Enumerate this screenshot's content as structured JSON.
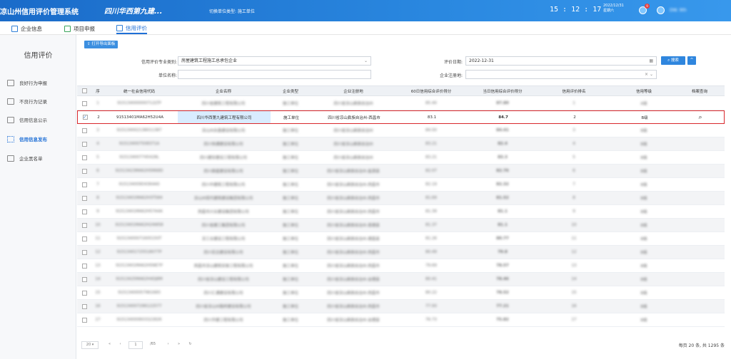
{
  "header": {
    "system_title": "凉山州信用评价管理系统",
    "company_name": "四川华西第九建...",
    "switch_type": "切换单位类型: 施工单位",
    "time": "15 : 12 : 17",
    "date": "2022/12/31",
    "weekday": "星期六",
    "badge_count": "9",
    "user_name": "DW. 9th"
  },
  "nav_tabs": [
    {
      "label": "企业信息",
      "icon": "building-icon"
    },
    {
      "label": "项目申报",
      "icon": "document-icon"
    },
    {
      "label": "信用评价",
      "icon": "columns-icon",
      "active": true
    }
  ],
  "sidebar": {
    "title": "信用评价",
    "items": [
      {
        "label": "良好行为申报",
        "icon": "report-icon"
      },
      {
        "label": "不良行为记录",
        "icon": "record-icon"
      },
      {
        "label": "信用信息公示",
        "icon": "home-icon"
      },
      {
        "label": "信用信息发布",
        "icon": "publish-icon",
        "active": true
      },
      {
        "label": "企业黑名单",
        "icon": "blacklist-icon"
      }
    ]
  },
  "toolbar": {
    "export_label": "⇪ 打开导出面板"
  },
  "filters": {
    "category_label": "信用评价专业类别:",
    "category_value": "房屋建筑工程施工总承包企业",
    "unit_label": "单位名称:",
    "unit_value": "",
    "eval_date_label": "评价日期:",
    "eval_date_value": "2022-12-31",
    "region_label": "企业注册地:",
    "region_value": "",
    "search_label": "搜索",
    "collapse_label": "^"
  },
  "table": {
    "columns": [
      "序",
      "统一社会信用代码",
      "企业名称",
      "企业类型",
      "企业注册地",
      "60日信用综合评价得分",
      "当日信用综合评价得分",
      "信用评价排名",
      "信用等级",
      "档案查询"
    ],
    "rows": [
      {
        "no": "1",
        "code": "915134000000712LTP",
        "name": "四川省建筑工程有限公司",
        "type": "施工单位",
        "region": "四川省凉山彝族自治州",
        "score60": "85.40",
        "score": "87.80",
        "rank": "1",
        "grade": "A级",
        "blurred": true
      },
      {
        "no": "2",
        "code": "91513401MA62H52U4A",
        "name": "四川华西第九建筑工程有限公司",
        "type": "施工单位",
        "region": "四川省凉山彝族自治州-西昌市",
        "score60": "83.1",
        "score": "84.7",
        "rank": "2",
        "grade": "B级",
        "selected": true
      },
      {
        "no": "3",
        "code": "915134002138011387",
        "name": "凉山州永鑫建设有限公司",
        "type": "施工单位",
        "region": "四川省凉山彝族自治州",
        "score60": "84.50",
        "score": "84.41",
        "rank": "3",
        "grade": "B级",
        "blurred": true
      },
      {
        "no": "4",
        "code": "915134007508371A",
        "name": "四川恒通建设有限公司",
        "type": "施工单位",
        "region": "四川省凉山彝族自治州",
        "score60": "83.21",
        "score": "82.4",
        "rank": "4",
        "grade": "B级",
        "blurred": true
      },
      {
        "no": "5",
        "code": "915134007745428L",
        "name": "四川建安建设工程有限公司",
        "type": "施工单位",
        "region": "四川省凉山彝族自治州",
        "score60": "83.21",
        "score": "83.3",
        "rank": "5",
        "grade": "B级",
        "blurred": true
      },
      {
        "no": "6",
        "code": "91513423MA62H5RN9D",
        "name": "四川鼎盛建设有限公司",
        "type": "施工单位",
        "region": "四川省凉山彝族自治州-盐源县",
        "score60": "82.07",
        "score": "82.76",
        "rank": "6",
        "grade": "B级",
        "blurred": true
      },
      {
        "no": "7",
        "code": "915134009D4364A0",
        "name": "四川中建筑工程有限公司",
        "type": "施工单位",
        "region": "四川省凉山彝族自治州-西昌市",
        "score60": "82.19",
        "score": "82.32",
        "rank": "7",
        "grade": "B级",
        "blurred": true
      },
      {
        "no": "8",
        "code": "91513401MA62H3T584",
        "name": "凉山州现代建筑建设集团有限公司",
        "type": "施工单位",
        "region": "四川省凉山彝族自治州-西昌市",
        "score60": "81.69",
        "score": "81.52",
        "rank": "8",
        "grade": "B级",
        "blurred": true
      },
      {
        "no": "9",
        "code": "91513401MA62H57A4A",
        "name": "西昌市兴业建设集团有限公司",
        "type": "施工单位",
        "region": "四川省凉山彝族自治州-西昌市",
        "score60": "81.39",
        "score": "81.1",
        "rank": "9",
        "grade": "B级",
        "blurred": true
      },
      {
        "no": "10",
        "code": "91513401MA62H24W58",
        "name": "四川省建工集团有限公司",
        "type": "施工单位",
        "region": "四川省凉山彝族自治州-喜德县",
        "score60": "81.37",
        "score": "81.1",
        "rank": "10",
        "grade": "B级",
        "blurred": true
      },
      {
        "no": "11",
        "code": "91513400071605150T",
        "name": "凉工业建设工程有限公司",
        "type": "施工单位",
        "region": "四川省凉山彝族自治州-德昌县",
        "score60": "81.26",
        "score": "80.77",
        "rank": "11",
        "grade": "B级",
        "blurred": true
      },
      {
        "no": "12",
        "code": "91513401725518077P",
        "name": "四川宏达建设有限公司",
        "type": "施工单位",
        "region": "四川省凉山彝族自治州-西昌市",
        "score60": "80.49",
        "score": "79.8",
        "rank": "12",
        "grade": "B级",
        "blurred": true
      },
      {
        "no": "13",
        "code": "91513401MA62H5NE7P",
        "name": "西昌市凉山建筑安装工程有限公司",
        "type": "施工单位",
        "region": "四川省凉山彝族自治州-西昌市",
        "score60": "79.69",
        "score": "78.57",
        "rank": "13",
        "grade": "B级",
        "blurred": true
      },
      {
        "no": "14",
        "code": "91513425MA62H4DJ8M",
        "name": "四川省凉山建设工程有限公司",
        "type": "施工单位",
        "region": "四川省凉山彝族自治州-会理县",
        "score60": "80.41",
        "score": "78.46",
        "rank": "14",
        "grade": "B级",
        "blurred": true
      },
      {
        "no": "15",
        "code": "91513400057961683",
        "name": "四川汇通建设有限公司",
        "type": "施工单位",
        "region": "四川省凉山彝族自治州-西昌市",
        "score60": "80.22",
        "score": "78.52",
        "rank": "15",
        "grade": "B级",
        "blurred": true
      },
      {
        "no": "16",
        "code": "915134007296122577",
        "name": "四川省凉山州路桥建设有限公司",
        "type": "施工单位",
        "region": "四川省凉山彝族自治州-西昌市",
        "score60": "77.93",
        "score": "77.21",
        "rank": "16",
        "grade": "B级",
        "blurred": true
      },
      {
        "no": "17",
        "code": "915134000603322826",
        "name": "四川华建工程有限公司",
        "type": "施工单位",
        "region": "四川省凉山彝族自治州-会理县",
        "score60": "76.73",
        "score": "75.82",
        "rank": "17",
        "grade": "B级",
        "blurred": true
      }
    ]
  },
  "pager": {
    "page_size": "20 ▾",
    "first": "«",
    "prev": "‹",
    "current": "1",
    "total_pages": "/65",
    "next": "›",
    "last": "»",
    "refresh": "↻",
    "total_text": "每页 20 条, 共 1295 条"
  }
}
